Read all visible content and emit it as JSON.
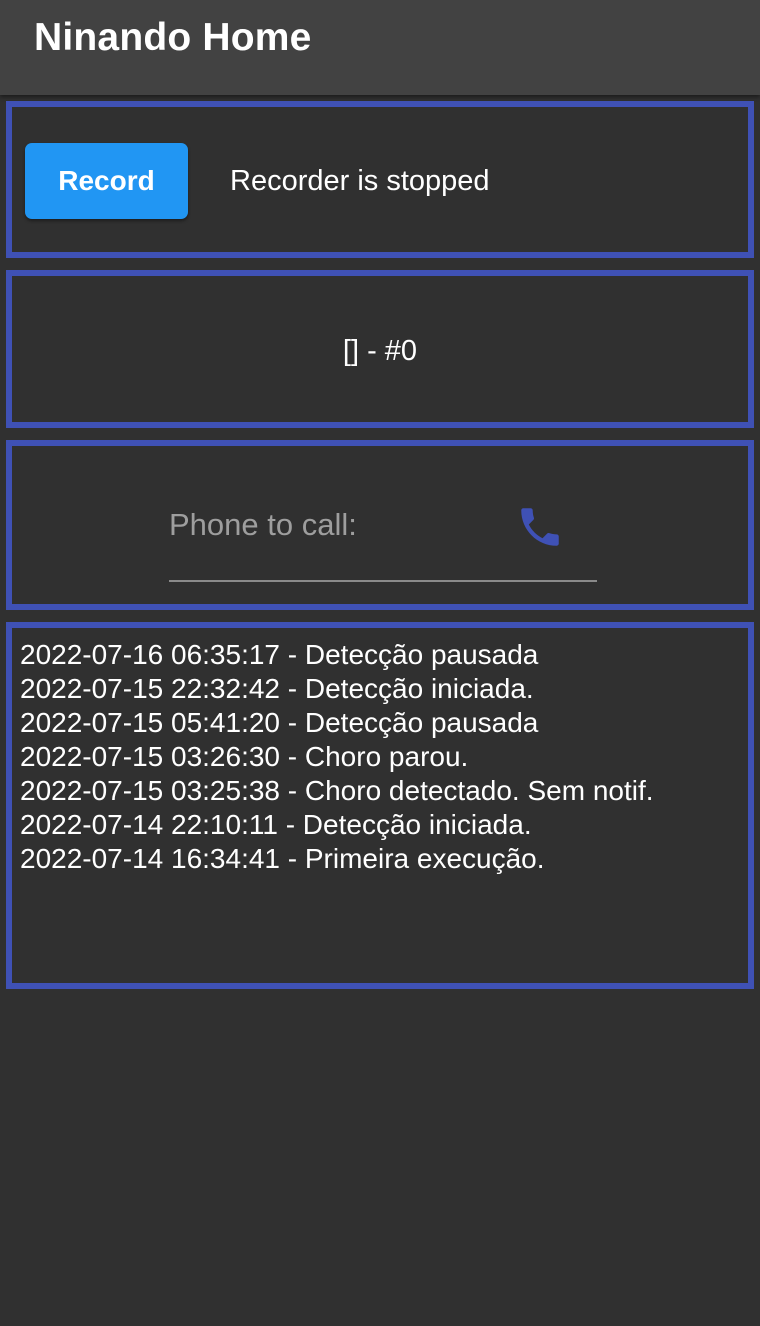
{
  "app_bar": {
    "title": "Ninando Home"
  },
  "recorder": {
    "button_label": "Record",
    "status": "Recorder is stopped"
  },
  "detection": {
    "status": "[] - #0"
  },
  "phone": {
    "placeholder": "Phone to call:",
    "value": "",
    "call_icon": "phone-icon"
  },
  "log": {
    "entries": [
      "2022-07-16 06:35:17 - Detecção pausada",
      "2022-07-15 22:32:42 - Detecção iniciada.",
      "2022-07-15 05:41:20 - Detecção pausada",
      "2022-07-15 03:26:30 - Choro parou.",
      "2022-07-15 03:25:38 - Choro detectado. Sem notif.",
      "2022-07-14 22:10:11 - Detecção iniciada.",
      "2022-07-14 16:34:41 - Primeira execução."
    ]
  },
  "colors": {
    "background": "#303030",
    "app_bar": "#424242",
    "panel_border": "#3f51b5",
    "record_button": "#2196f3",
    "call_icon": "#3f51b5"
  }
}
